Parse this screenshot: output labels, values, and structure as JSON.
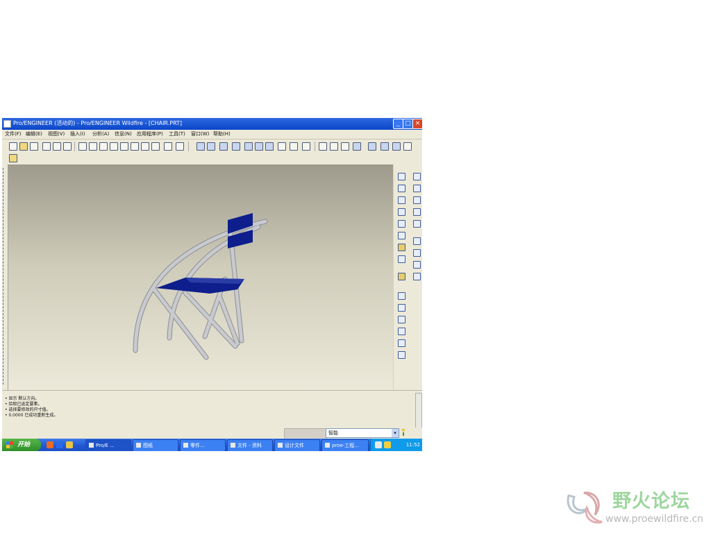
{
  "window": {
    "title": "Pro/ENGINEER  (活动的) - Pro/ENGINEER Wildfire - [CHAIR.PRT]",
    "controls": {
      "minimize": "_",
      "maximize": "□",
      "close": "×"
    }
  },
  "menu": [
    "文件(F)",
    "编辑(E)",
    "视图(V)",
    "插入(I)",
    "分析(A)",
    "信息(N)",
    "应用程序(P)",
    "工具(T)",
    "窗口(W)",
    "帮助(H)"
  ],
  "icons": {
    "toolbar": [
      "new-icon",
      "open-icon",
      "save-icon",
      "print-icon",
      "email-icon",
      "email-link-icon",
      "undo-icon",
      "redo-icon",
      "cut-icon",
      "copy-icon",
      "paste-icon",
      "paste-special-icon",
      "regenerate-icon",
      "model-tree-icon",
      "datum-plane-icon",
      "datum-axis-icon",
      "datum-point-icon",
      "zoom-in-icon",
      "zoom-out-icon",
      "refit-icon",
      "reorient-icon",
      "spin-center-icon",
      "saved-views-icon",
      "layers-icon",
      "wireframe-icon",
      "hidden-line-icon",
      "no-hidden-icon",
      "shading-icon",
      "plane-display-icon",
      "axis-display-icon",
      "point-display-icon",
      "csys-display-icon",
      "whats-this-icon"
    ],
    "feature_toolbar": [
      "sketch-icon",
      "datum-curve-icon",
      "line-icon",
      "spline-icon",
      "csys-icon",
      "analysis-feature-icon",
      "extrude-icon",
      "revolve-icon",
      "variable-sweep-icon",
      "blend-icon",
      "hole-icon",
      "round-icon",
      "chamfer-icon",
      "draft-icon",
      "shell-icon",
      "rib-icon",
      "pattern-icon",
      "mirror-icon",
      "merge-icon",
      "trim-icon",
      "offset-icon",
      "thicken-icon",
      "solidify-icon"
    ]
  },
  "message_area": {
    "lines": [
      "• 显示 默认方向。",
      "• 拾取已选定要素。",
      "• 选择要修改的尺寸值。",
      "• 0.0000 已成功重新生成。"
    ]
  },
  "status": {
    "filter_value": "智能",
    "filter_arrow": "▾"
  },
  "taskbar": {
    "start_label": "开始",
    "quick_launch": [
      "browser-icon",
      "media-icon",
      "folder-icon"
    ],
    "tasks": [
      "Pro/E ...",
      "图纸",
      "零件...",
      "文件 - 资料",
      "设计文件",
      "proe-工程..."
    ],
    "clock": "11:52"
  },
  "watermark": {
    "title": "野火论坛",
    "url": "www.proewildfire.cn"
  },
  "colors": {
    "titlebar": "#0a46c8",
    "chair_frame": "#c2c4c8",
    "chair_panels": "#0e1e8c",
    "watermark_green": "#9ed69e",
    "taskbar": "#2256d2",
    "start_button": "#3c9a32"
  }
}
